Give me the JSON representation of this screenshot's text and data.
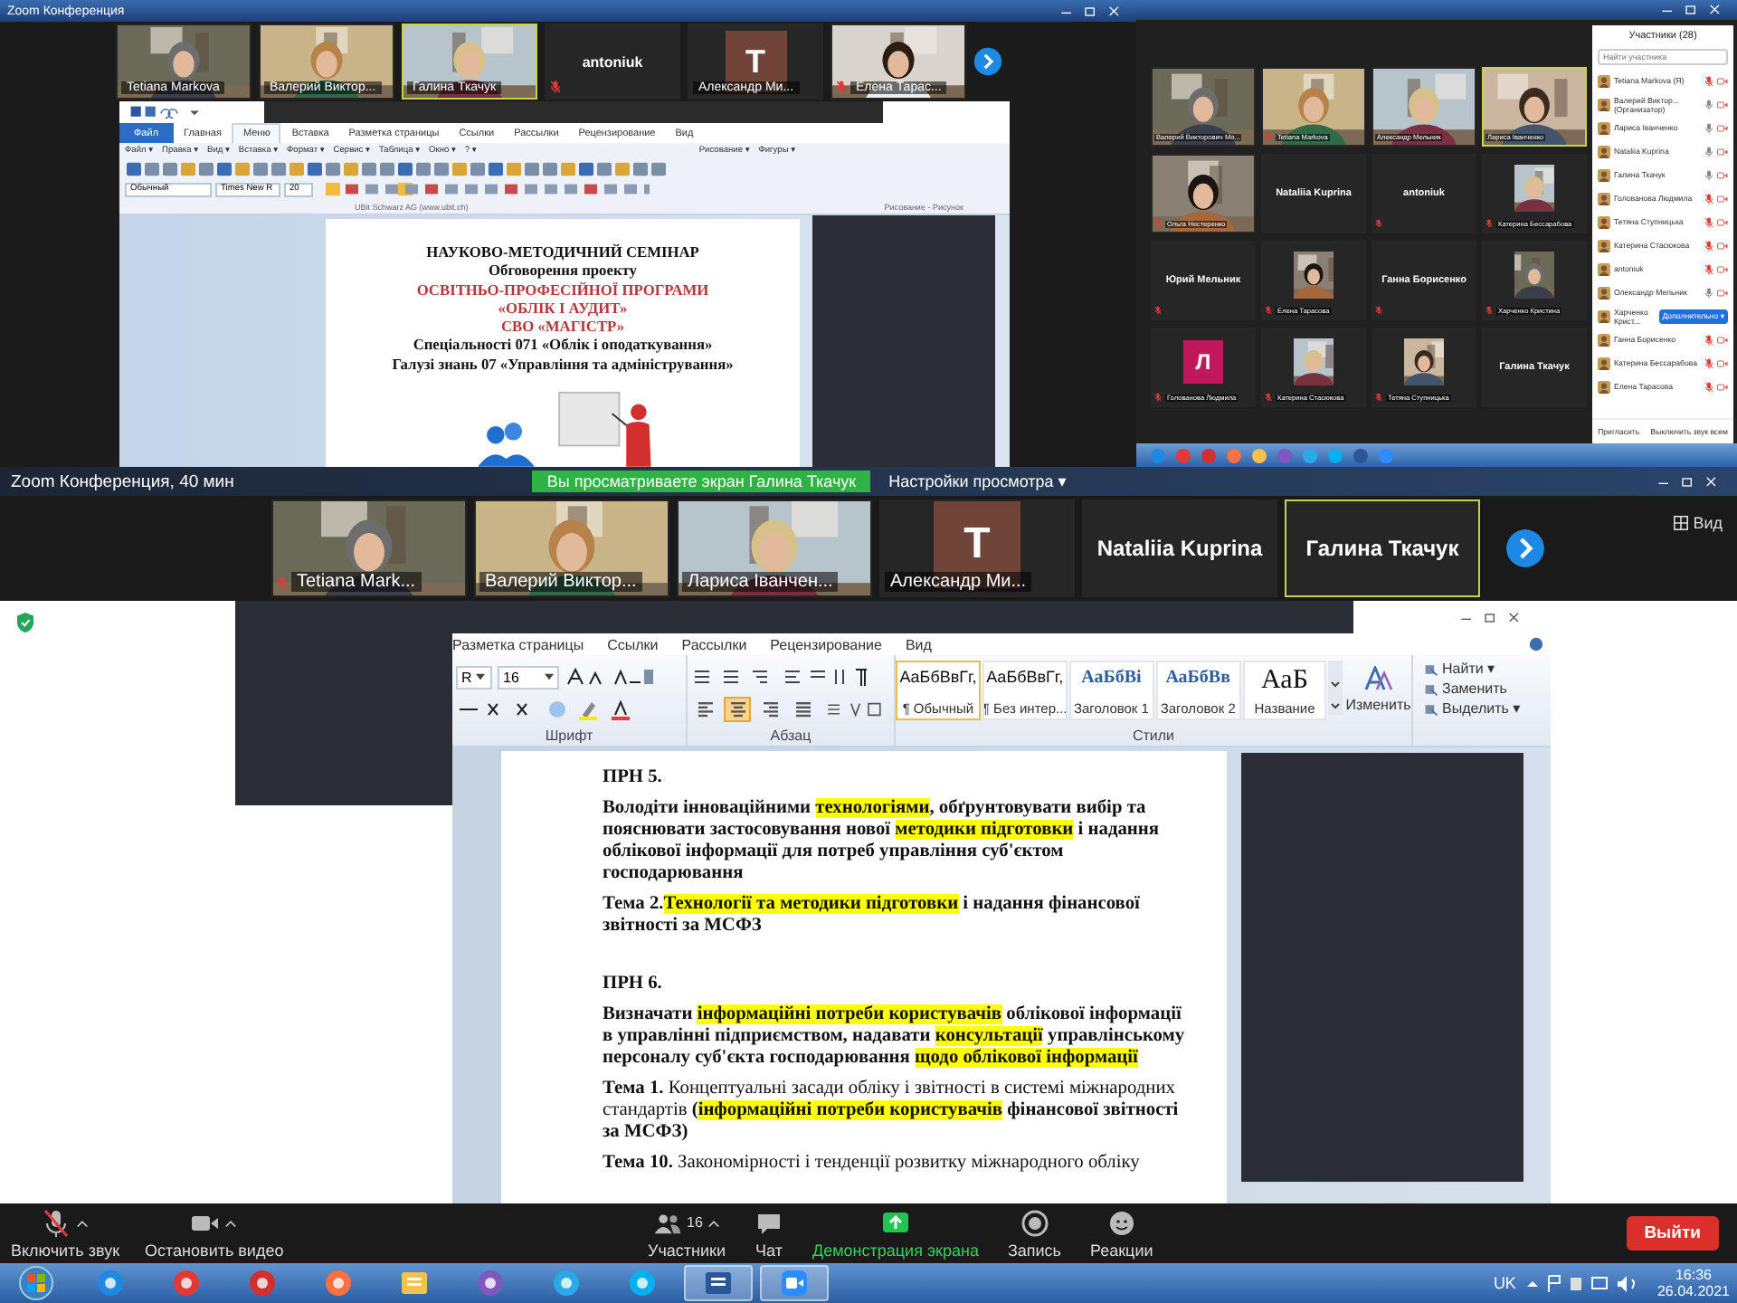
{
  "top_left": {
    "title": "Zoom Конференция",
    "thumbnails": [
      {
        "kind": "video",
        "name": "Tetiana Markova",
        "muted": false,
        "active": false
      },
      {
        "kind": "video",
        "name": "Валерий Виктор...",
        "muted": false,
        "active": false
      },
      {
        "kind": "video",
        "name": "Галина Ткачук",
        "muted": false,
        "active": true
      },
      {
        "kind": "name",
        "name": "antoniuk",
        "muted": true,
        "active": false
      },
      {
        "kind": "avatar",
        "initial": "T",
        "color": "#6e4538",
        "name": "Александр Ми...",
        "muted": false,
        "active": false
      },
      {
        "kind": "video",
        "name": "Елена Тарас...",
        "muted": true,
        "active": false
      }
    ],
    "word": {
      "tabs": [
        {
          "label": "Файл",
          "kind": "file",
          "selected": false
        },
        {
          "label": "Главная",
          "kind": "tab",
          "selected": false
        },
        {
          "label": "Меню",
          "kind": "tab",
          "selected": true
        },
        {
          "label": "Вставка",
          "kind": "tab",
          "selected": false
        },
        {
          "label": "Разметка страницы",
          "kind": "tab",
          "selected": false
        },
        {
          "label": "Ссылки",
          "kind": "tab",
          "selected": false
        },
        {
          "label": "Рассылки",
          "kind": "tab",
          "selected": false
        },
        {
          "label": "Рецензирование",
          "kind": "tab",
          "selected": false
        },
        {
          "label": "Вид",
          "kind": "tab",
          "selected": false
        }
      ],
      "menu": [
        "Файл ▾",
        "Правка ▾",
        "Вид ▾",
        "Вставка ▾",
        "Формат ▾",
        "Сервис ▾",
        "Таблица ▾",
        "Окно ▾",
        "? ▾"
      ],
      "drawing_menu": "Рисование ▾",
      "shapes_menu": "Фигуры ▾",
      "style_field": "Обычный",
      "font_field": "Times New R",
      "size_field": "20",
      "toolbar_caption": "UBit Schwarz AG   (www.ubit.ch)",
      "drawing_caption": "Рисование - Рисунок",
      "document": [
        {
          "text": "НАУКОВО-МЕТОДИЧНИЙ СЕМІНАР",
          "kind": "heading"
        },
        {
          "text": "Обговорення проекту",
          "kind": "heading"
        },
        {
          "text": "ОСВІТНЬО-ПРОФЕСІЙНОЇ ПРОГРАМИ",
          "kind": "accent"
        },
        {
          "text": "«ОБЛІК І АУДИТ»",
          "kind": "accent"
        },
        {
          "text": "СВО «МАГІСТР»",
          "kind": "accent"
        },
        {
          "text": "Спеціальності 071 «Облік і оподаткування»",
          "kind": "heading"
        },
        {
          "text": "Галузі знань 07 «Управління та адміністрування»",
          "kind": "heading"
        }
      ]
    }
  },
  "top_right": {
    "tiles": [
      {
        "kind": "video",
        "name": "Валерий Викторович Мо...",
        "muted": false,
        "active": false
      },
      {
        "kind": "video",
        "name": "Tetiana Markova",
        "muted": true,
        "active": false
      },
      {
        "kind": "video",
        "name": "Александр Мельник",
        "muted": false,
        "active": false
      },
      {
        "kind": "video",
        "name": "Лариса Іванченко",
        "muted": false,
        "active": true
      },
      {
        "kind": "video",
        "name": "Ольга Нестеренко",
        "muted": true,
        "active": false
      },
      {
        "kind": "name",
        "name": "Nataliia Kuprina",
        "muted": false,
        "active": false
      },
      {
        "kind": "name",
        "name": "antoniuk",
        "muted": true,
        "active": false
      },
      {
        "kind": "portrait",
        "name": "Катерина Бессарабова",
        "muted": true,
        "active": false
      },
      {
        "kind": "name",
        "name": "Юрий Мельник",
        "muted": true,
        "active": false
      },
      {
        "kind": "portrait",
        "name": "Елена Тарасова",
        "muted": true,
        "active": false
      },
      {
        "kind": "name",
        "name": "Ганна Борисенко",
        "muted": true,
        "active": false
      },
      {
        "kind": "portrait",
        "name": "Харченко Кристина",
        "muted": true,
        "active": false
      },
      {
        "kind": "avatar",
        "initial": "Л",
        "color": "#c2185b",
        "name": "Голованова Людмила",
        "muted": true,
        "active": false
      },
      {
        "kind": "portrait",
        "name": "Катерина Стасюкова",
        "muted": true,
        "active": false
      },
      {
        "kind": "portrait",
        "name": "Тетяна Ступницька",
        "muted": true,
        "active": false
      },
      {
        "kind": "name",
        "name": "Галина Ткачук",
        "muted": false,
        "active": false
      }
    ],
    "panel": {
      "title": "Участники (28)",
      "search": {
        "placeholder": "Найти участника"
      },
      "participants": [
        {
          "name": "Tetiana Markova (Я)",
          "muted": true
        },
        {
          "name": "Валерий Виктор... (Организатор)",
          "muted": false
        },
        {
          "name": "Лариса Іванченко",
          "muted": false
        },
        {
          "name": "Nataliia Kuprina",
          "muted": false
        },
        {
          "name": "Галина Ткачук",
          "muted": false
        },
        {
          "name": "Голованова Людмила",
          "muted": true
        },
        {
          "name": "Тетяна Ступницька",
          "muted": true
        },
        {
          "name": "Катерина Стасюкова",
          "muted": true
        },
        {
          "name": "antoniuk",
          "muted": true
        },
        {
          "name": "Олександр Мельник",
          "muted": false
        },
        {
          "name": "Харченко Крист...",
          "action": "Дополнительно ▾"
        },
        {
          "name": "Ганна Борисенко",
          "muted": true
        },
        {
          "name": "Катерина Бессарабова",
          "muted": true
        },
        {
          "name": "Елена Тарасова",
          "muted": true
        }
      ],
      "buttons": [
        "Пригласить",
        "Выключить звук всем"
      ]
    }
  },
  "bottom": {
    "title": "Zoom Конференция, 40 мин",
    "banner": "Вы просматриваете экран Галина Ткачук",
    "view_settings": "Настройки просмотра ▾",
    "thumbnails": [
      {
        "kind": "video",
        "name": "Tetiana Mark...",
        "muted": true,
        "active": false
      },
      {
        "kind": "video",
        "name": "Валерий Виктор...",
        "muted": false,
        "active": false
      },
      {
        "kind": "video",
        "name": "Лариса Іванчен...",
        "muted": false,
        "active": false
      },
      {
        "kind": "avatar",
        "initial": "T",
        "color": "#6e4538",
        "name": "Александр Ми...",
        "muted": false,
        "active": false
      },
      {
        "kind": "name",
        "name": "Nataliia Kuprina",
        "muted": false,
        "active": false
      },
      {
        "kind": "name",
        "name": "Галина Ткачук",
        "muted": false,
        "active": true
      }
    ],
    "view_button": "Вид",
    "word": {
      "tabs": [
        "Разметка страницы",
        "Ссылки",
        "Рассылки",
        "Рецензирование",
        "Вид"
      ],
      "font_field": "R",
      "size_field": "16",
      "align": [
        {
          "kind": "left",
          "selected": false
        },
        {
          "kind": "center",
          "selected": true
        },
        {
          "kind": "right",
          "selected": false
        },
        {
          "kind": "justify",
          "selected": false
        }
      ],
      "styles": [
        {
          "sample": "АаБбВвГг,",
          "label": "¶ Обычный",
          "kind": "body",
          "selected": true
        },
        {
          "sample": "АаБбВвГг,",
          "label": "¶ Без интер...",
          "kind": "body",
          "selected": false
        },
        {
          "sample": "АаБбВі",
          "label": "Заголовок 1",
          "kind": "heading",
          "selected": false
        },
        {
          "sample": "АаБбВв",
          "label": "Заголовок 2",
          "kind": "heading",
          "selected": false
        },
        {
          "sample": "АаБ",
          "label": "Название",
          "kind": "title",
          "selected": false
        }
      ],
      "change_styles": "Изменить",
      "editing": [
        "Найти ▾",
        "Заменить",
        "Выделить ▾"
      ],
      "groups": [
        "Шрифт",
        "Абзац",
        "Стили"
      ],
      "paragraphs": [
        {
          "kind": "section",
          "segments": [
            {
              "text": "ПРН 5.",
              "bold": true,
              "highlight": false
            }
          ]
        },
        {
          "kind": "body",
          "segments": [
            {
              "text": "Володіти інноваційними ",
              "bold": true,
              "highlight": false
            },
            {
              "text": "технологіями",
              "bold": true,
              "highlight": true
            },
            {
              "text": ", обґрунтовувати вибір та пояснювати застосовування нової ",
              "bold": true,
              "highlight": false
            },
            {
              "text": "методики підготовки",
              "bold": true,
              "highlight": true
            },
            {
              "text": " і надання облікової інформації для потреб управління суб'єктом господарювання",
              "bold": true,
              "highlight": false
            }
          ]
        },
        {
          "kind": "body",
          "segments": [
            {
              "text": "Тема 2.",
              "bold": true,
              "highlight": false
            },
            {
              "text": "Технології та методики",
              "bold": true,
              "highlight": true
            },
            {
              "text": " підготовки",
              "bold": true,
              "highlight": true
            },
            {
              "text": " і надання фінансової звітності за МСФЗ",
              "bold": true,
              "highlight": false
            }
          ]
        },
        {
          "kind": "section",
          "segments": [
            {
              "text": "ПРН 6.",
              "bold": true,
              "highlight": false
            }
          ]
        },
        {
          "kind": "body",
          "segments": [
            {
              "text": "Визначати ",
              "bold": true,
              "highlight": false
            },
            {
              "text": "інформаційні потреби користувачів",
              "bold": true,
              "highlight": true
            },
            {
              "text": " облікової інформації в управлінні підприємством, надавати ",
              "bold": true,
              "highlight": false
            },
            {
              "text": "консультації",
              "bold": true,
              "highlight": true
            },
            {
              "text": " управлінському персоналу суб'єкта господарювання ",
              "bold": true,
              "highlight": false
            },
            {
              "text": "щодо облікової інформації",
              "bold": true,
              "highlight": true
            }
          ]
        },
        {
          "kind": "body",
          "segments": [
            {
              "text": "Тема 1.",
              "bold": true,
              "highlight": false
            },
            {
              "text": " Концептуальні засади обліку і звітності в системі міжнародних стандартів ",
              "bold": false,
              "highlight": false
            },
            {
              "text": "(",
              "bold": true,
              "highlight": false
            },
            {
              "text": "інформаційні потреби користувачів",
              "bold": true,
              "highlight": true
            },
            {
              "text": " фінансової звітності за МСФЗ)",
              "bold": true,
              "highlight": false
            }
          ]
        },
        {
          "kind": "body",
          "segments": [
            {
              "text": "Тема 10.",
              "bold": true,
              "highlight": false
            },
            {
              "text": " Закономірності і тенденції розвитку міжнародного обліку",
              "bold": false,
              "highlight": false
            }
          ]
        }
      ]
    },
    "toolbar": {
      "buttons": [
        {
          "kind": "audio",
          "label": "Включить звук"
        },
        {
          "kind": "video",
          "label": "Остановить видео"
        },
        {
          "kind": "participants",
          "label": "Участники",
          "count": "16"
        },
        {
          "kind": "chat",
          "label": "Чат"
        },
        {
          "kind": "share",
          "label": "Демонстрация экрана"
        },
        {
          "kind": "record",
          "label": "Запись"
        },
        {
          "kind": "reactions",
          "label": "Реакции"
        }
      ],
      "exit": "Выйти"
    }
  },
  "taskbar": {
    "apps": [
      {
        "kind": "ie",
        "active": false
      },
      {
        "kind": "chrome",
        "active": false
      },
      {
        "kind": "opera",
        "active": false
      },
      {
        "kind": "firefox",
        "active": false
      },
      {
        "kind": "explorer",
        "active": false
      },
      {
        "kind": "viber",
        "active": false
      },
      {
        "kind": "telegram",
        "active": false
      },
      {
        "kind": "skype",
        "active": false
      },
      {
        "kind": "word",
        "active": true
      },
      {
        "kind": "zoom",
        "active": true
      }
    ],
    "language": "UK",
    "time": "16:36",
    "date": "26.04.2021"
  }
}
